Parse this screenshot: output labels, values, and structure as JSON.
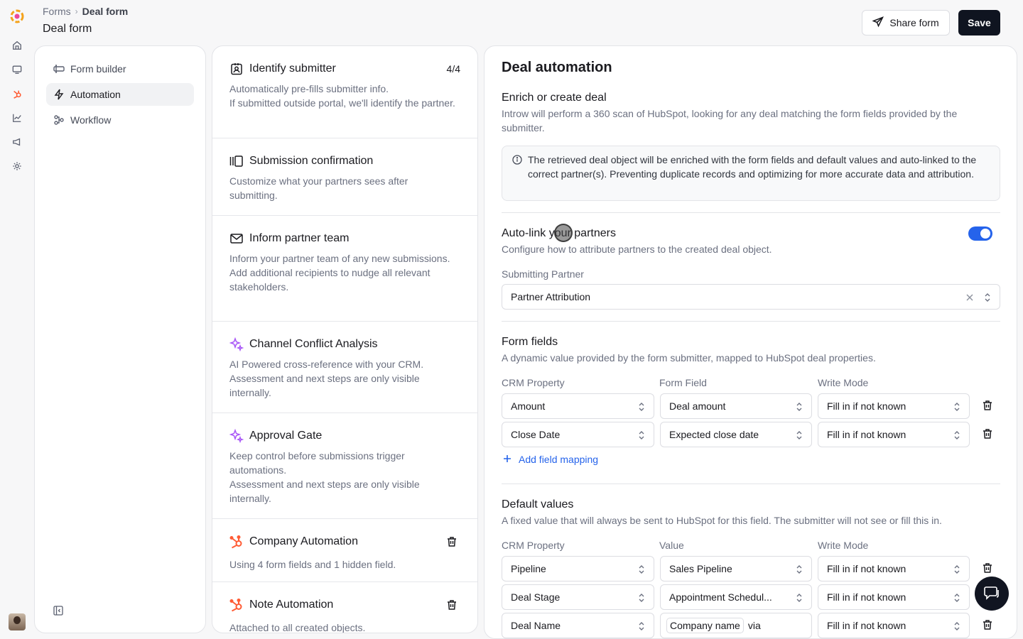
{
  "breadcrumb": {
    "parent": "Forms",
    "current": "Deal form"
  },
  "page": {
    "title": "Deal form"
  },
  "header": {
    "share_label": "Share form",
    "save_label": "Save"
  },
  "sidebar": {
    "items": [
      {
        "label": "Form builder",
        "icon": "form-builder-icon"
      },
      {
        "label": "Automation",
        "icon": "bolt-icon"
      },
      {
        "label": "Workflow",
        "icon": "workflow-icon"
      }
    ]
  },
  "automations": [
    {
      "title": "Identify submitter",
      "count": "4/4",
      "desc": "Automatically pre-fills submitter info.\nIf submitted outside portal, we'll identify the partner."
    },
    {
      "title": "Submission confirmation",
      "desc": "Customize what your partners sees after submitting."
    },
    {
      "title": "Inform partner team",
      "desc": "Inform your partner team of any new submissions.\nAdd additional recipients to nudge all relevant stakeholders."
    },
    {
      "title": "Channel Conflict Analysis",
      "desc": "AI Powered cross-reference with your CRM. Assessment and next steps are only visible internally."
    },
    {
      "title": "Approval Gate",
      "desc": "Keep control before submissions trigger automations.\nAssessment and next steps are only visible internally."
    },
    {
      "title": "Company Automation",
      "desc": "Using 4 form fields and 1 hidden field."
    },
    {
      "title": "Note Automation",
      "desc": "Attached to all created objects."
    }
  ],
  "detail": {
    "title": "Deal automation",
    "enrich": {
      "title": "Enrich or create deal",
      "desc": "Introw will perform a 360 scan of HubSpot, looking for any deal matching the form fields provided by the submitter.",
      "info": "The retrieved deal object will be enriched with the form fields and default values and auto-linked to the correct partner(s). Preventing duplicate records and optimizing for more accurate data and attribution."
    },
    "autolink": {
      "title": "Auto-link your partners",
      "desc": "Configure how to attribute partners to the created deal object.",
      "enabled": true,
      "field_label": "Submitting Partner",
      "field_value": "Partner Attribution"
    },
    "form_fields": {
      "title": "Form fields",
      "desc": "A dynamic value provided by the form submitter, mapped to HubSpot deal properties.",
      "col_crm": "CRM Property",
      "col_field": "Form Field",
      "col_mode": "Write Mode",
      "rows": [
        {
          "crm": "Amount",
          "field": "Deal amount",
          "mode": "Fill in if not known"
        },
        {
          "crm": "Close Date",
          "field": "Expected close date",
          "mode": "Fill in if not known"
        }
      ],
      "add_label": "Add field mapping"
    },
    "defaults": {
      "title": "Default values",
      "desc": "A fixed value that will always be sent to HubSpot for this field. The submitter will not see or fill this in.",
      "col_crm": "CRM Property",
      "col_value": "Value",
      "col_mode": "Write Mode",
      "rows": [
        {
          "crm": "Pipeline",
          "value": "Sales Pipeline",
          "mode": "Fill in if not known"
        },
        {
          "crm": "Deal Stage",
          "value": "Appointment Schedul...",
          "mode": "Fill in if not known"
        },
        {
          "crm": "Deal Name",
          "chip": "Company name",
          "value_suffix": "via",
          "mode": "Fill in if not known"
        }
      ]
    }
  },
  "colors": {
    "accent": "#2563eb",
    "primary_button": "#0f1420",
    "hubspot": "#ff5c35",
    "ai": "#a855f7"
  }
}
